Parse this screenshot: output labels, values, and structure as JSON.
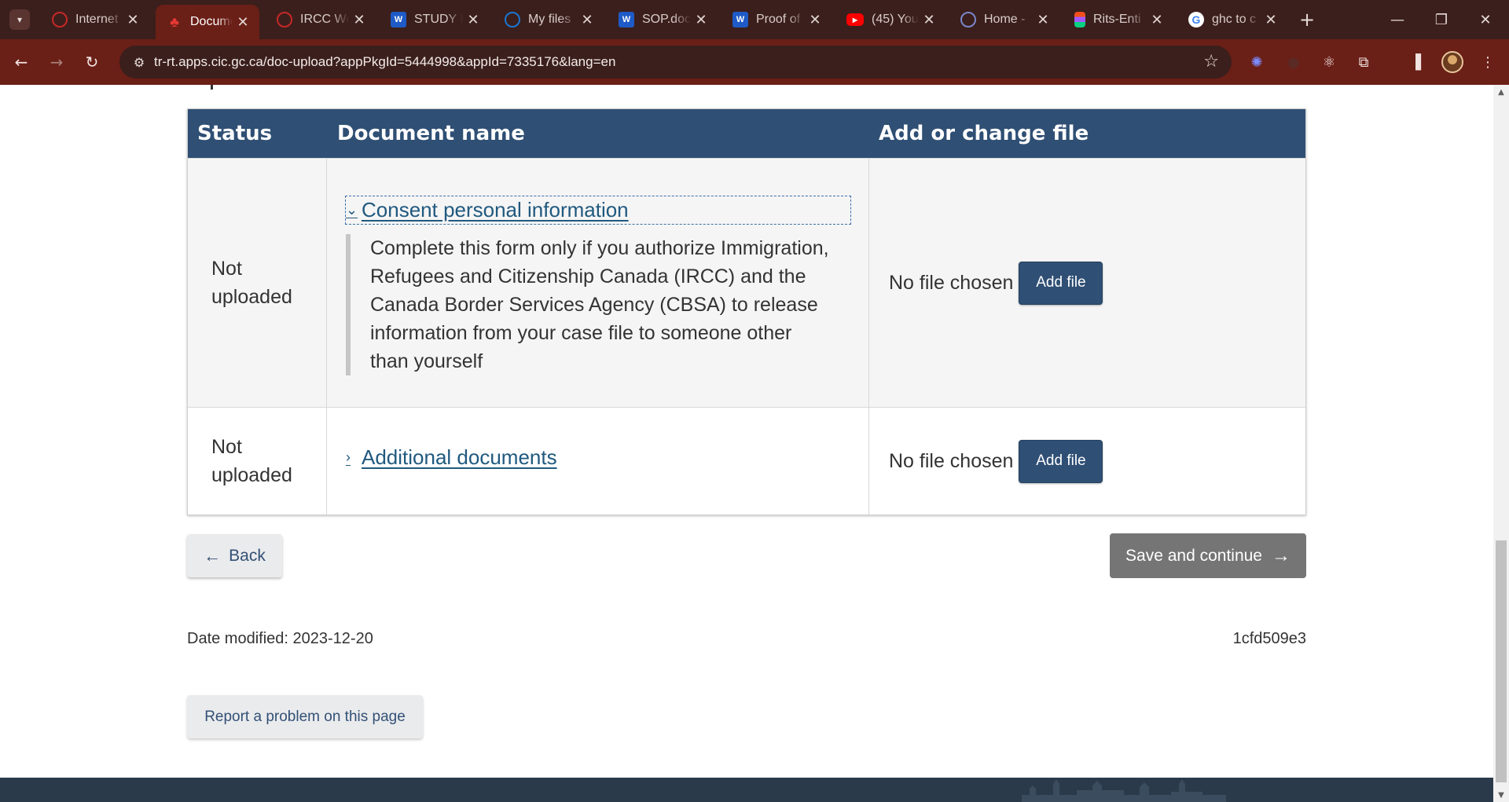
{
  "browser": {
    "tabs": [
      {
        "title": "Internet",
        "favicon_color": "#c62828",
        "favicon_icon": "ircc-icon"
      },
      {
        "title": "Docume",
        "favicon_color": "#d32f2f",
        "favicon_icon": "maple-leaf-icon",
        "active": true
      },
      {
        "title": "IRCC We",
        "favicon_color": "#c62828",
        "favicon_icon": "ircc-icon"
      },
      {
        "title": "STUDY P",
        "favicon_color": "#1e5bc6",
        "favicon_icon": "word-icon"
      },
      {
        "title": "My files",
        "favicon_color": "#1976d2",
        "favicon_icon": "onedrive-icon"
      },
      {
        "title": "SOP.doc",
        "favicon_color": "#1e5bc6",
        "favicon_icon": "word-icon"
      },
      {
        "title": "Proof of",
        "favicon_color": "#1e5bc6",
        "favicon_icon": "word-icon"
      },
      {
        "title": "(45) You",
        "favicon_color": "#ff0000",
        "favicon_icon": "youtube-icon"
      },
      {
        "title": "Home - ",
        "favicon_color": "#5c6bc0",
        "favicon_icon": "site-icon"
      },
      {
        "title": "Rits-Enti",
        "favicon_color": "#f24e1e",
        "favicon_icon": "figma-icon"
      },
      {
        "title": "ghc to c",
        "favicon_color": "#4285f4",
        "favicon_icon": "google-icon"
      }
    ],
    "url": "tr-rt.apps.cic.gc.ca/doc-upload?appPkgId=5444998&appId=7335176&lang=en"
  },
  "table": {
    "headers": {
      "status": "Status",
      "name": "Document name",
      "file": "Add or change file"
    },
    "rows": [
      {
        "status": "Not uploaded",
        "name": "Consent personal information",
        "expanded": true,
        "details": "Complete this form only if you authorize Immigration, Refugees and Citizenship Canada (IRCC) and the Canada Border Services Agency (CBSA) to release information from your case file to someone other than yourself",
        "file_status": "No file chosen",
        "button": "Add file"
      },
      {
        "status": "Not uploaded",
        "name": "Additional documents",
        "expanded": false,
        "file_status": "No file chosen",
        "button": "Add file"
      }
    ]
  },
  "actions": {
    "back": "Back",
    "save": "Save and continue"
  },
  "footer_info": {
    "date_label": "Date modified:",
    "date_value": "2023-12-20",
    "version": "1cfd509e3",
    "report": "Report a problem on this page"
  },
  "colors": {
    "header_bg": "#2f4f74",
    "link": "#20597f",
    "tab_bar": "#3b1f1c",
    "toolbar": "#6a1f17",
    "save_button": "#757575"
  }
}
